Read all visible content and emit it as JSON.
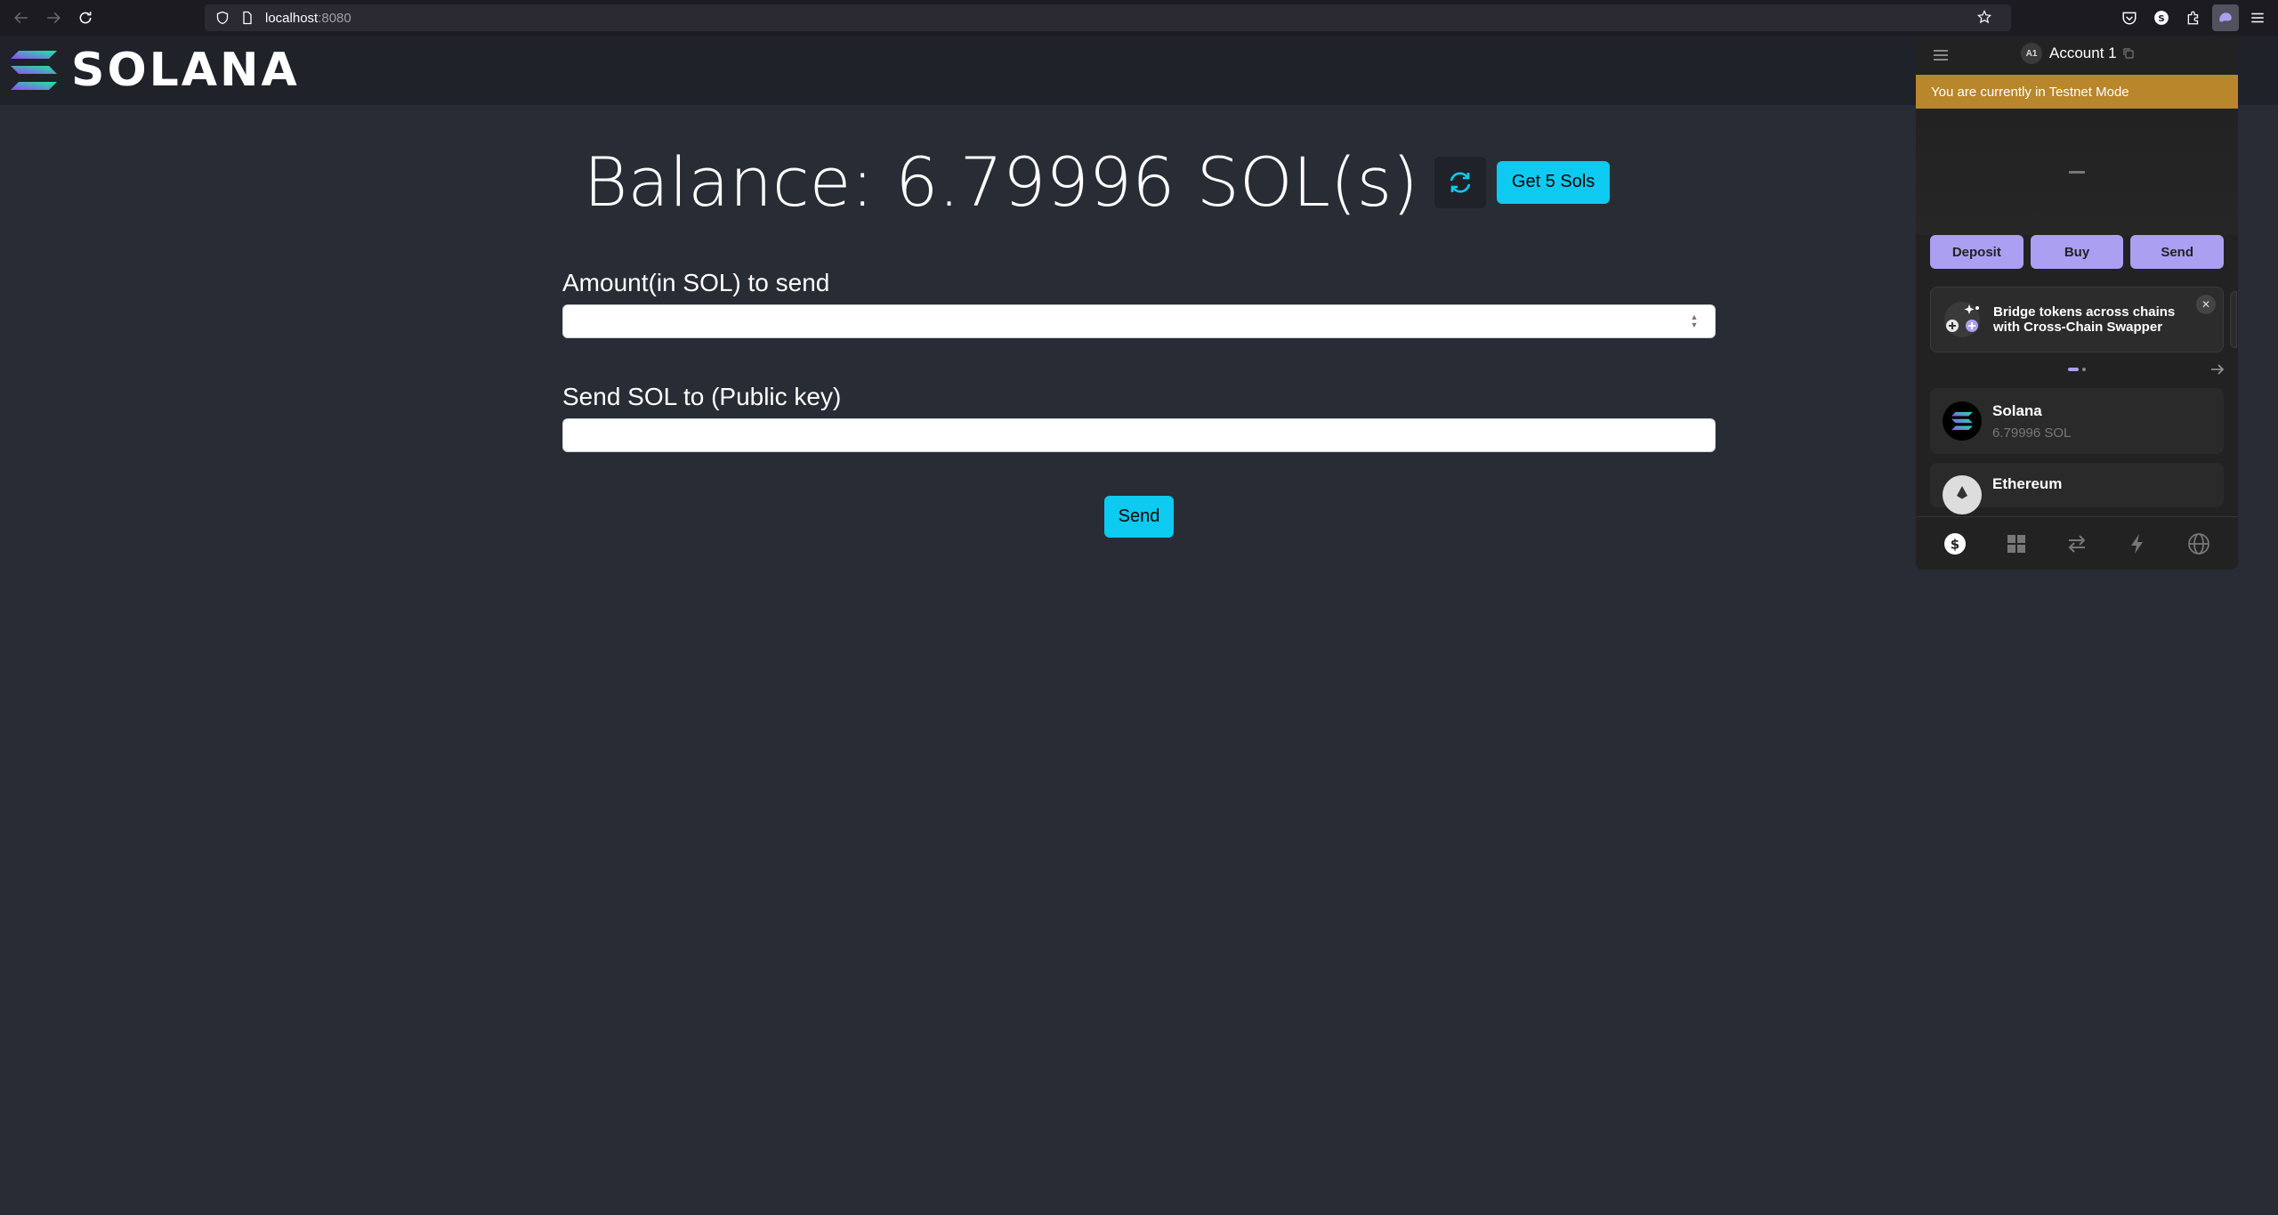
{
  "browser": {
    "url_host": "localhost",
    "url_port": ":8080"
  },
  "site": {
    "logo_text": "SOLANA"
  },
  "main": {
    "balance_title": "Balance: 6.79996 SOL(s)",
    "get_sols_label": "Get 5 Sols",
    "amount_label": "Amount(in SOL) to send",
    "amount_value": "",
    "pubkey_label": "Send SOL to (Public key)",
    "pubkey_value": "",
    "send_label": "Send"
  },
  "wallet": {
    "avatar_initials": "A1",
    "account_name": "Account 1",
    "testnet_banner": "You are currently in Testnet Mode",
    "balance_placeholder": "-",
    "actions": {
      "deposit": "Deposit",
      "buy": "Buy",
      "send": "Send"
    },
    "promo_text": "Bridge tokens across chains with Cross-Chain Swapper",
    "tokens": [
      {
        "name": "Solana",
        "amount": "6.79996 SOL"
      },
      {
        "name": "Ethereum",
        "amount": ""
      }
    ],
    "accent_color": "#ab9ff2",
    "banner_color": "#b8862b"
  },
  "colors": {
    "primary_button": "#0dcaf0",
    "page_background": "#282c34"
  }
}
